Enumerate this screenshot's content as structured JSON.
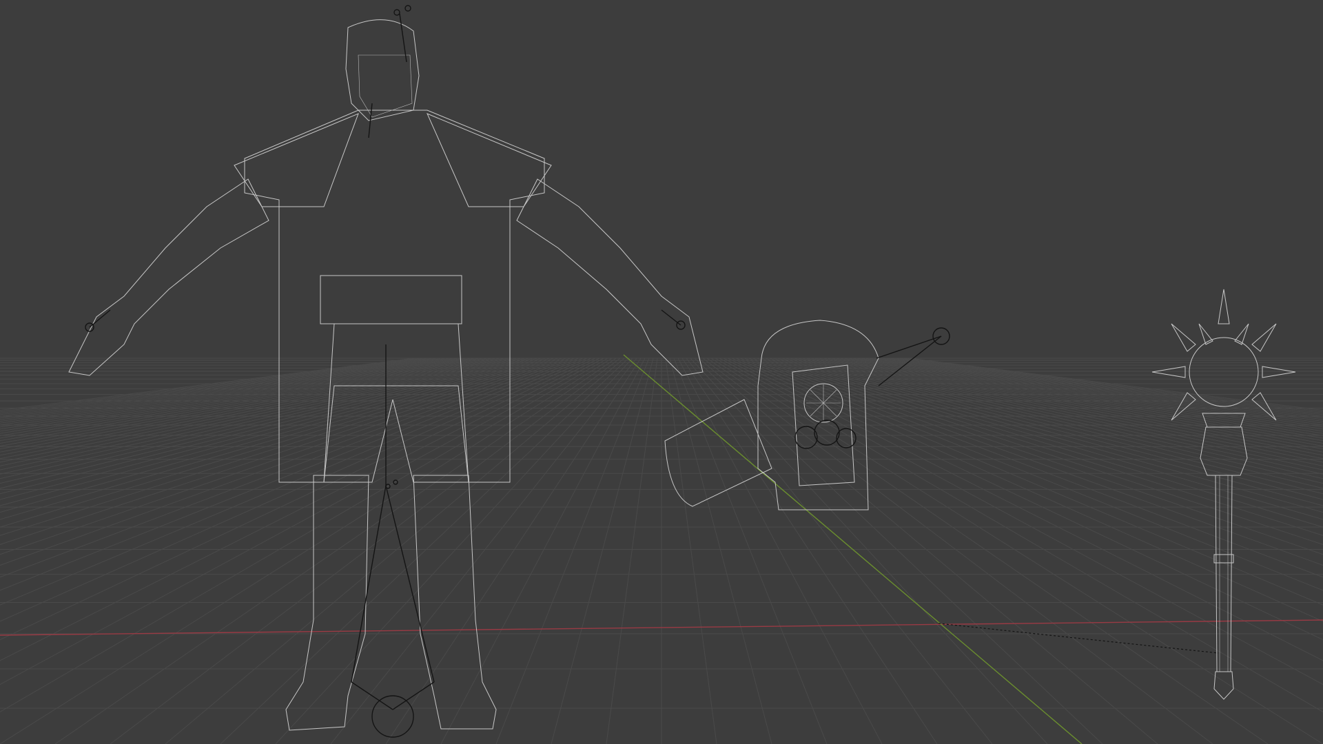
{
  "viewport": {
    "mode": "wireframe",
    "background": "#3d3d3d",
    "grid_color": "#4a4a4a",
    "wire_color": "#c8c8c8",
    "bone_color": "#141414",
    "x_axis_color": "#9a3a44",
    "y_axis_color": "#6b8f2e"
  },
  "objects": [
    {
      "name": "character-armored-warrior",
      "type": "mesh-with-armature"
    },
    {
      "name": "hammer-weapon",
      "type": "mesh-with-empty"
    },
    {
      "name": "spiked-mace",
      "type": "mesh"
    }
  ]
}
